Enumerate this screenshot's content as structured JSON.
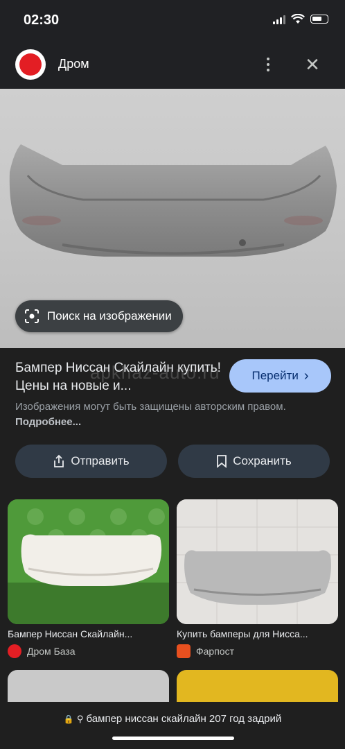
{
  "status": {
    "time": "02:30"
  },
  "header": {
    "site_name": "Дром"
  },
  "hero": {
    "lens_label": "Поиск на изображении"
  },
  "result": {
    "title": "Бампер Ниссан Скайлайн купить! Цены на новые и...",
    "watermark": "apkhaz-auto.ru",
    "go_label": "Перейти",
    "notice": "Изображения могут быть защищены авторским правом.",
    "notice_more": "Подробнее..."
  },
  "actions": {
    "share_label": "Отправить",
    "save_label": "Сохранить"
  },
  "related": [
    {
      "title": "Бампер Ниссан Скайлайн...",
      "source": "Дром База",
      "source_color": "#e31e24"
    },
    {
      "title": "Купить бамперы для Нисса...",
      "source": "Фарпост",
      "source_color": "#e8501f"
    }
  ],
  "urlbar": {
    "query": "бампер ниссан скайлайн 207 год задрий"
  }
}
